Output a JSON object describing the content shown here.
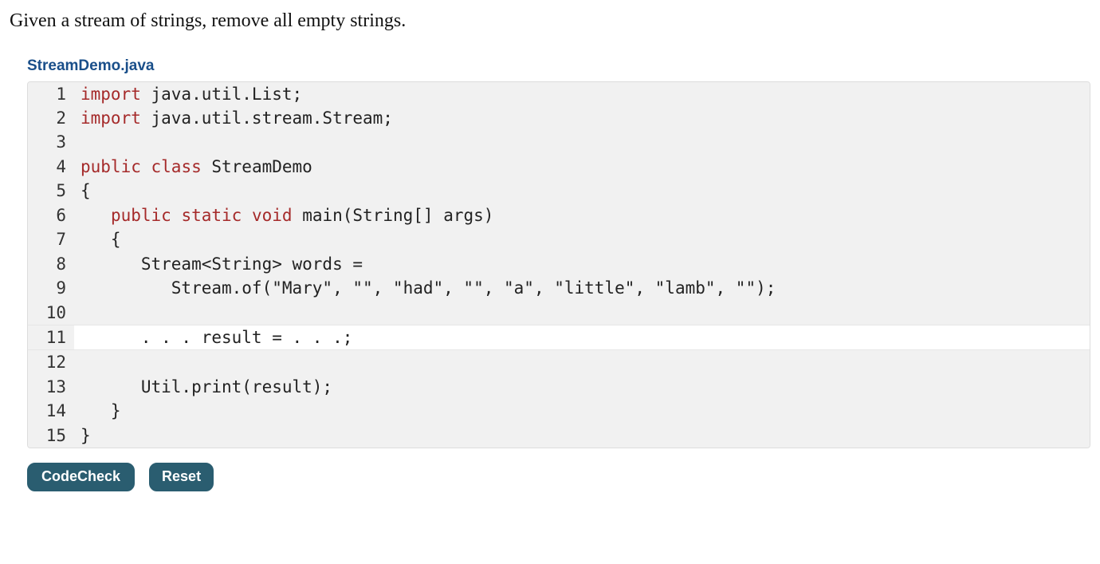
{
  "problem": "Given a stream of strings, remove all empty strings.",
  "filename": "StreamDemo.java",
  "code": {
    "lines": [
      {
        "n": "1",
        "editable": false,
        "segments": [
          {
            "cls": "kw",
            "t": "import"
          },
          {
            "cls": "plain",
            "t": " java.util.List;"
          }
        ]
      },
      {
        "n": "2",
        "editable": false,
        "segments": [
          {
            "cls": "kw",
            "t": "import"
          },
          {
            "cls": "plain",
            "t": " java.util.stream.Stream;"
          }
        ]
      },
      {
        "n": "3",
        "editable": false,
        "segments": [
          {
            "cls": "plain",
            "t": ""
          }
        ]
      },
      {
        "n": "4",
        "editable": false,
        "segments": [
          {
            "cls": "kw",
            "t": "public"
          },
          {
            "cls": "plain",
            "t": " "
          },
          {
            "cls": "kw",
            "t": "class"
          },
          {
            "cls": "plain",
            "t": " StreamDemo"
          }
        ]
      },
      {
        "n": "5",
        "editable": false,
        "segments": [
          {
            "cls": "plain",
            "t": "{"
          }
        ]
      },
      {
        "n": "6",
        "editable": false,
        "segments": [
          {
            "cls": "plain",
            "t": "   "
          },
          {
            "cls": "kw",
            "t": "public"
          },
          {
            "cls": "plain",
            "t": " "
          },
          {
            "cls": "kw",
            "t": "static"
          },
          {
            "cls": "plain",
            "t": " "
          },
          {
            "cls": "kw",
            "t": "void"
          },
          {
            "cls": "plain",
            "t": " main(String[] args)"
          }
        ]
      },
      {
        "n": "7",
        "editable": false,
        "segments": [
          {
            "cls": "plain",
            "t": "   {"
          }
        ]
      },
      {
        "n": "8",
        "editable": false,
        "segments": [
          {
            "cls": "plain",
            "t": "      Stream<String> words ="
          }
        ]
      },
      {
        "n": "9",
        "editable": false,
        "segments": [
          {
            "cls": "plain",
            "t": "         Stream.of(\"Mary\", \"\", \"had\", \"\", \"a\", \"little\", \"lamb\", \"\");"
          }
        ]
      },
      {
        "n": "10",
        "editable": false,
        "segments": [
          {
            "cls": "plain",
            "t": ""
          }
        ]
      },
      {
        "n": "11",
        "editable": true,
        "segments": [
          {
            "cls": "plain",
            "t": "      . . . result = . . .;"
          }
        ]
      },
      {
        "n": "12",
        "editable": false,
        "segments": [
          {
            "cls": "plain",
            "t": ""
          }
        ]
      },
      {
        "n": "13",
        "editable": false,
        "segments": [
          {
            "cls": "plain",
            "t": "      Util.print(result);"
          }
        ]
      },
      {
        "n": "14",
        "editable": false,
        "segments": [
          {
            "cls": "plain",
            "t": "   }"
          }
        ]
      },
      {
        "n": "15",
        "editable": false,
        "segments": [
          {
            "cls": "plain",
            "t": "}"
          }
        ]
      }
    ]
  },
  "buttons": {
    "check": "CodeCheck",
    "reset": "Reset"
  }
}
